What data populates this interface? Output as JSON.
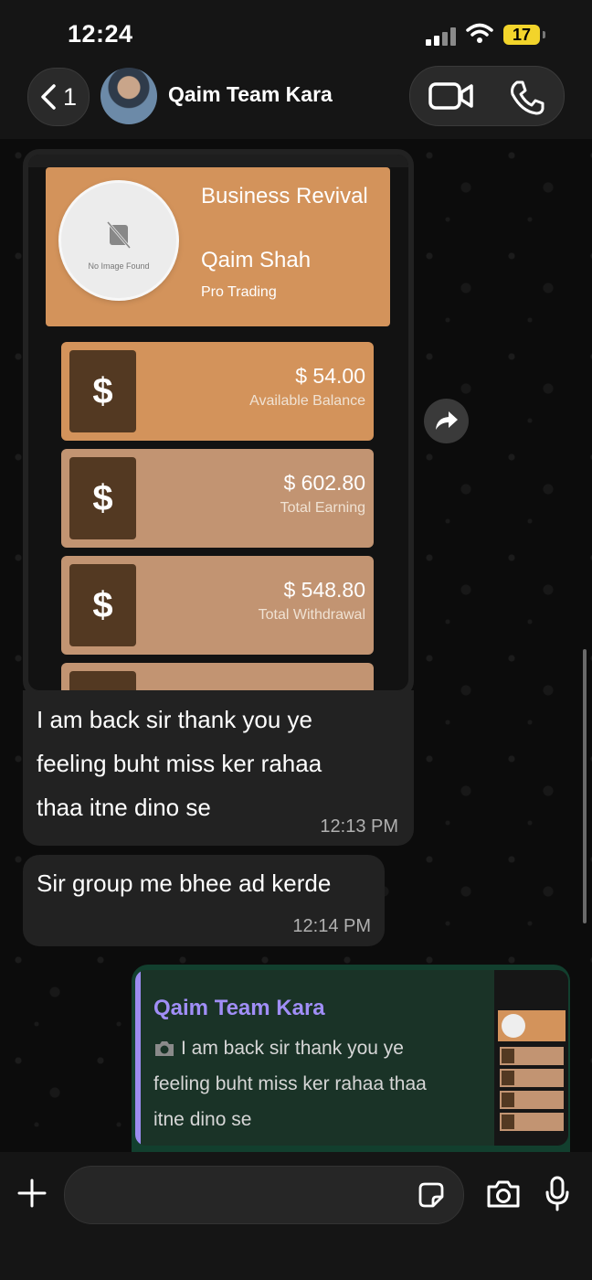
{
  "status_bar": {
    "time": "12:24",
    "battery": "17"
  },
  "header": {
    "back_count": "1",
    "contact_name": "Qaim Team Kara"
  },
  "screenshot": {
    "no_image_text": "No Image Found",
    "business_name": "Business Revival",
    "owner": "Qaim Shah",
    "plan": "Pro Trading",
    "currency_symbol": "$",
    "cards": [
      {
        "amount": "$ 54.00",
        "caption": "Available Balance"
      },
      {
        "amount": "$ 602.80",
        "caption": "Total Earning"
      },
      {
        "amount": "$ 548.80",
        "caption": "Total Withdrawal"
      }
    ]
  },
  "messages": [
    {
      "lines": [
        "I am back sir thank you ye",
        "feeling buht miss ker rahaa",
        "thaa itne dino se"
      ],
      "time": "12:13 PM"
    },
    {
      "lines": [
        "Sir group me bhee ad kerde"
      ],
      "time": "12:14 PM"
    }
  ],
  "outgoing": {
    "quote_name": "Qaim Team Kara",
    "quote_lines": [
      "I am back sir thank you ye",
      "feeling buht miss ker rahaa thaa",
      "itne dino se"
    ]
  },
  "colors": {
    "accent": "#9b8cf0",
    "card": "#d3935b",
    "card_alt": "#c29472",
    "outgoing": "#123f2e"
  }
}
